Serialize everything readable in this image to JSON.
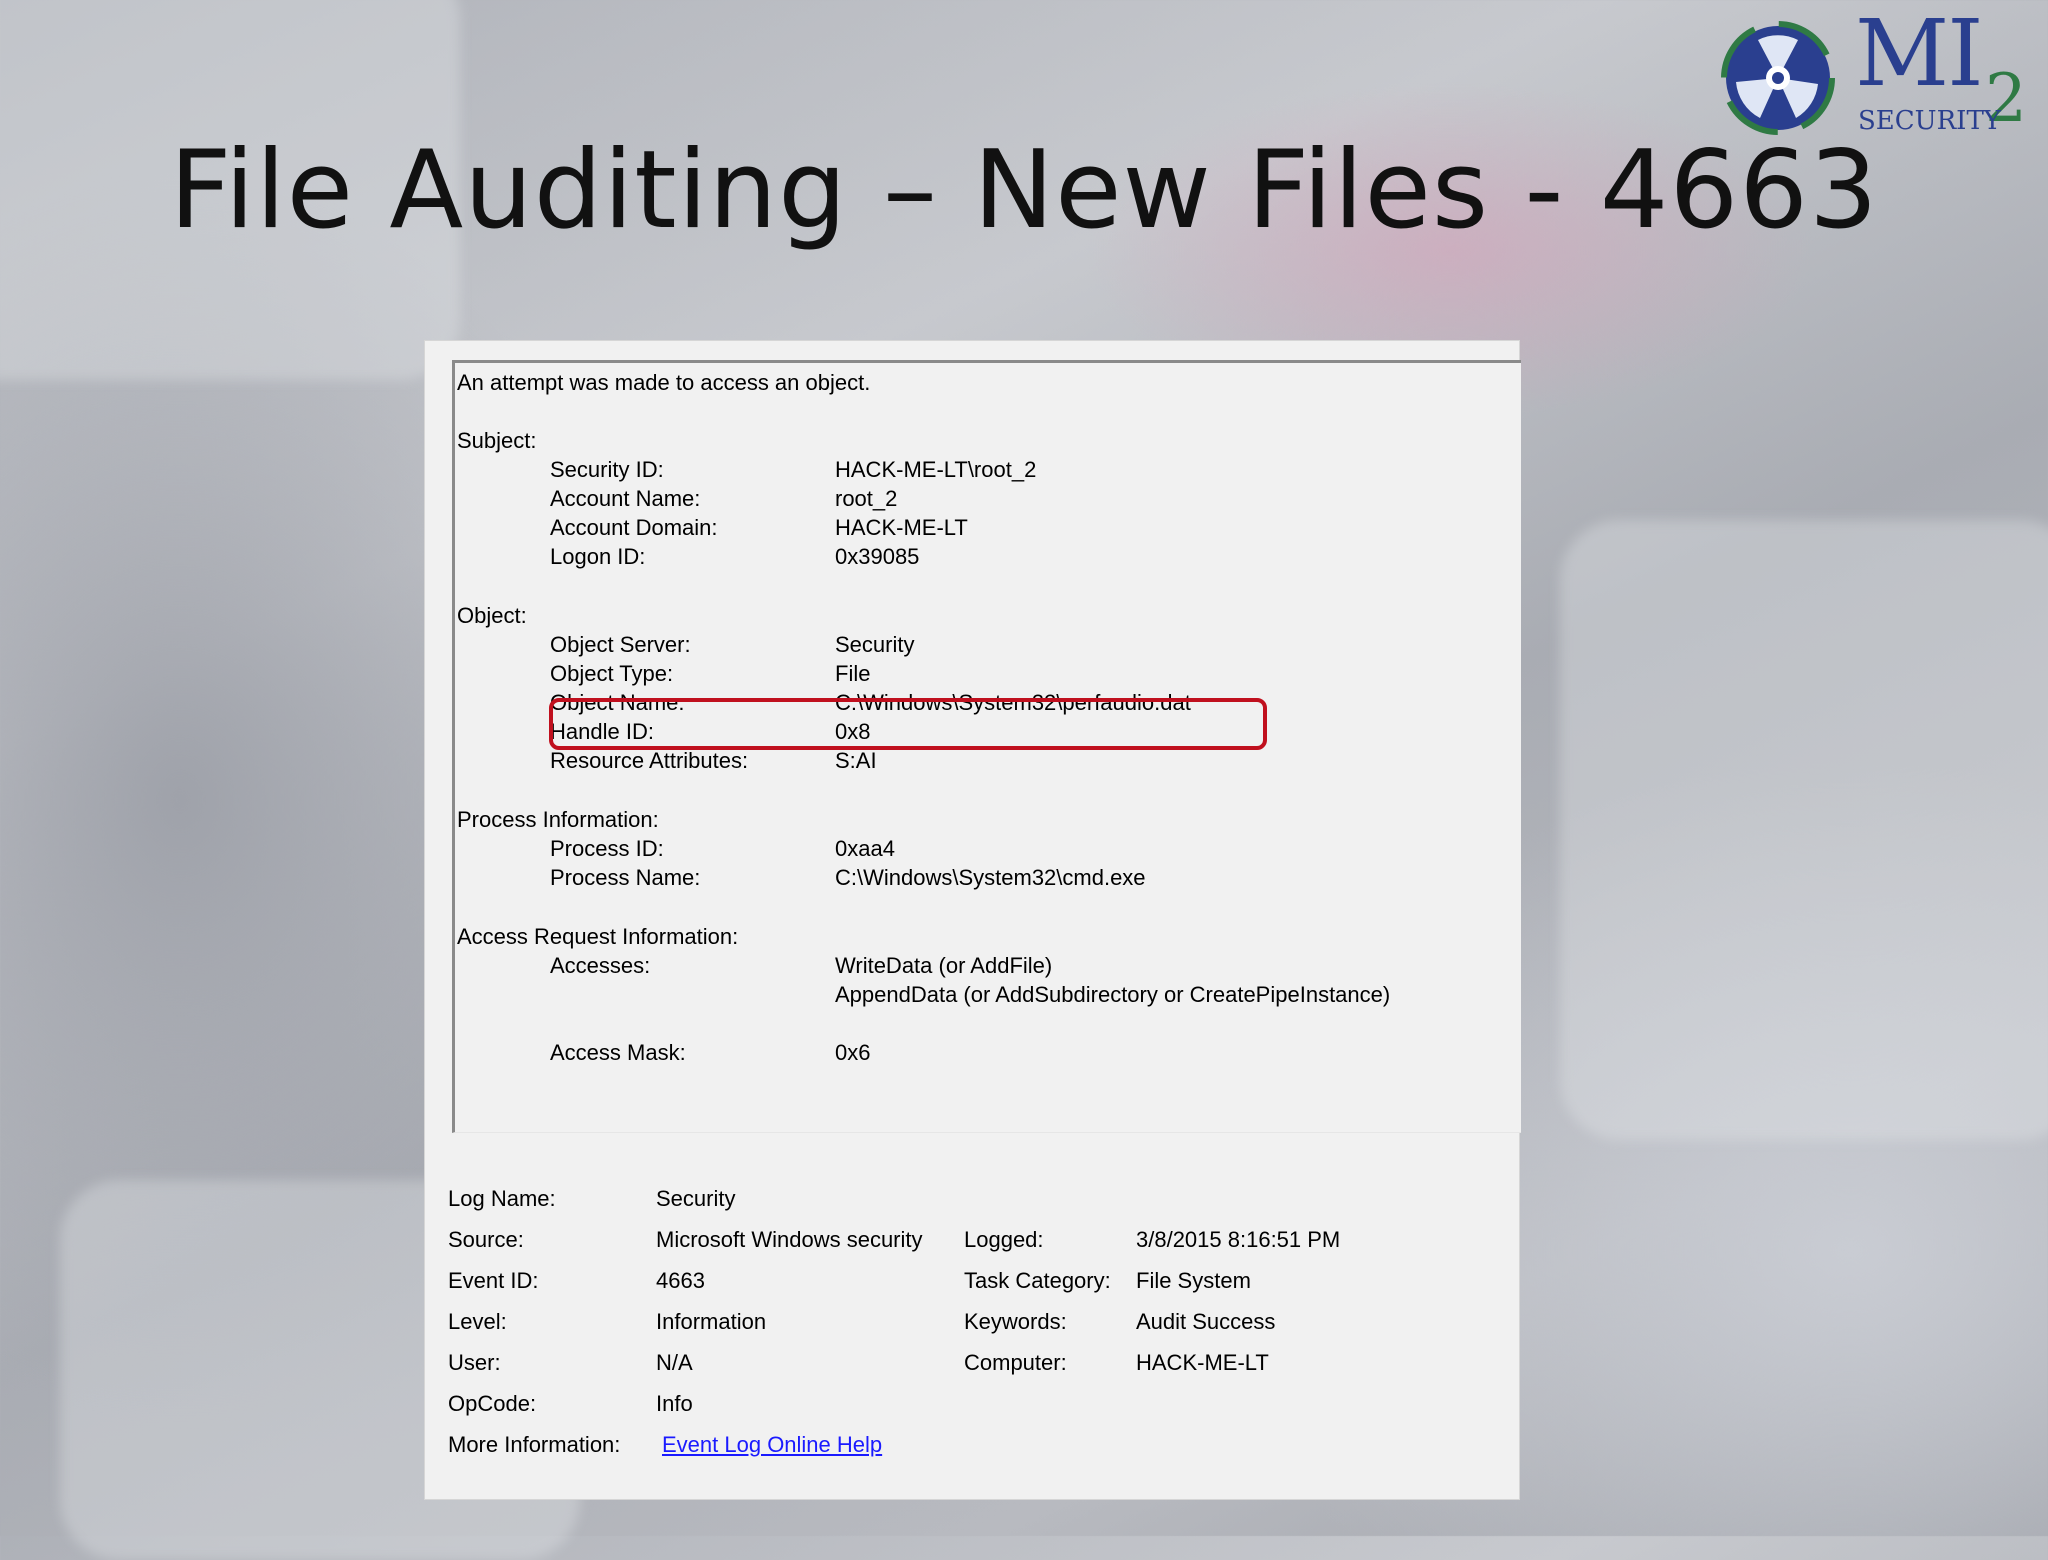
{
  "slide": {
    "title": "File Auditing – New Files - 4663"
  },
  "logo": {
    "brand": "MI",
    "subscript": "2",
    "tagline": "SECURITY"
  },
  "event": {
    "description": "An attempt was made to access an object.",
    "subject": {
      "heading": "Subject:",
      "fields": [
        {
          "label": "Security ID:",
          "value": "HACK-ME-LT\\root_2"
        },
        {
          "label": "Account Name:",
          "value": "root_2"
        },
        {
          "label": "Account Domain:",
          "value": "HACK-ME-LT"
        },
        {
          "label": "Logon ID:",
          "value": "0x39085"
        }
      ]
    },
    "object": {
      "heading": "Object:",
      "fields": [
        {
          "label": "Object Server:",
          "value": "Security"
        },
        {
          "label": "Object Type:",
          "value": "File"
        },
        {
          "label": "Object Name:",
          "value": "C:\\Windows\\System32\\perfaudio.dat"
        },
        {
          "label": "Handle ID:",
          "value": "0x8"
        },
        {
          "label": "Resource Attributes:",
          "value": "S:AI"
        }
      ]
    },
    "process": {
      "heading": "Process Information:",
      "fields": [
        {
          "label": "Process ID:",
          "value": "0xaa4"
        },
        {
          "label": "Process Name:",
          "value": "C:\\Windows\\System32\\cmd.exe"
        }
      ]
    },
    "access": {
      "heading": "Access Request Information:",
      "accesses_label": "Accesses:",
      "accesses": [
        "WriteData (or AddFile)",
        "AppendData (or AddSubdirectory or CreatePipeInstance)"
      ],
      "mask_label": "Access Mask:",
      "mask_value": "0x6"
    }
  },
  "details": {
    "log_name": {
      "label": "Log Name:",
      "value": "Security"
    },
    "source": {
      "label": "Source:",
      "value": "Microsoft Windows security"
    },
    "logged": {
      "label": "Logged:",
      "value": "3/8/2015 8:16:51 PM"
    },
    "event_id": {
      "label": "Event ID:",
      "value": "4663"
    },
    "task_category": {
      "label": "Task Category:",
      "value": "File System"
    },
    "level": {
      "label": "Level:",
      "value": "Information"
    },
    "keywords": {
      "label": "Keywords:",
      "value": "Audit Success"
    },
    "user": {
      "label": "User:",
      "value": "N/A"
    },
    "computer": {
      "label": "Computer:",
      "value": "HACK-ME-LT"
    },
    "opcode": {
      "label": "OpCode:",
      "value": "Info"
    },
    "more_info": {
      "label": "More Information:",
      "link": "Event Log Online Help"
    }
  },
  "colors": {
    "highlight_border": "#c0101e",
    "link": "#1a1aff",
    "logo_blue": "#2a3f8f",
    "logo_green": "#2f7a44"
  }
}
